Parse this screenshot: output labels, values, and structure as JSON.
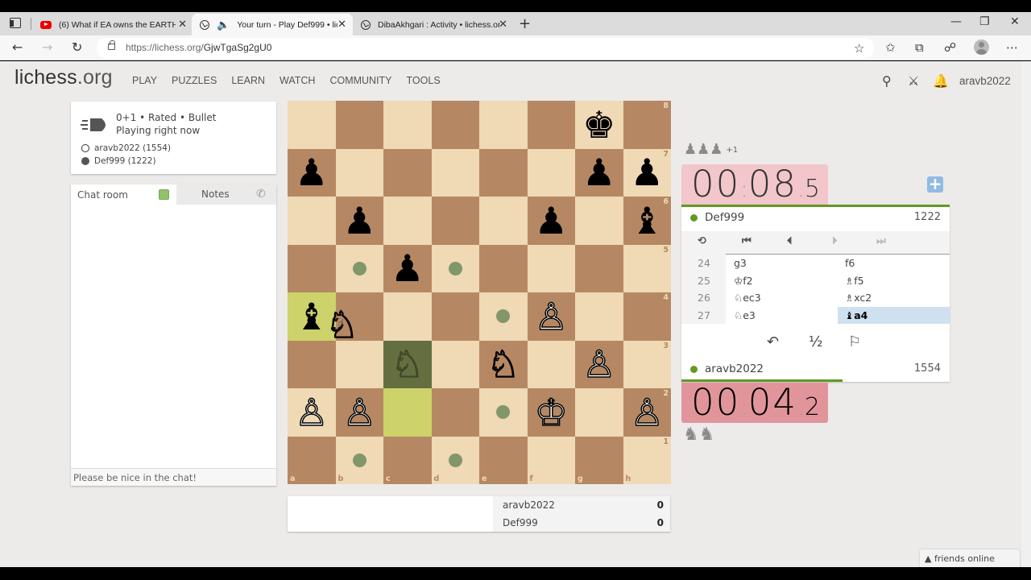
{
  "browser": {
    "tabs": [
      {
        "title": "(6) What if EA owns the EARTH |",
        "icon": "youtube-icon",
        "active": false
      },
      {
        "title": "Your turn - Play Def999 • lic",
        "icon": "lichess-icon",
        "audio": true,
        "active": true
      },
      {
        "title": "DibaAkhgari : Activity • lichess.or",
        "icon": "lichess-icon",
        "active": false
      }
    ],
    "url_host": "https://lichess.org/",
    "url_path": "GjwTgaSg2gU0",
    "icons": {
      "back": "←",
      "forward": "→",
      "reload": "↻",
      "new_tab": "+",
      "minimize": "—",
      "maximize": "❐",
      "close": "✕",
      "more": "⋯",
      "tab_close": "✕",
      "speaker": "🔈"
    }
  },
  "site": {
    "logo_main": "lichess",
    "logo_suffix": ".org",
    "menu": [
      "PLAY",
      "PUZZLES",
      "LEARN",
      "WATCH",
      "COMMUNITY",
      "TOOLS"
    ],
    "username": "aravb2022"
  },
  "game_info": {
    "line1": "0+1 • Rated • Bullet",
    "line2": "Playing right now",
    "white_player": "aravb2022 (1554)",
    "black_player": "Def999 (1222)"
  },
  "chat": {
    "tab_chat": "Chat room",
    "tab_notes": "Notes",
    "placeholder": "Please be nice in the chat!"
  },
  "board": {
    "files": [
      "a",
      "b",
      "c",
      "d",
      "e",
      "f",
      "g",
      "h"
    ],
    "ranks": [
      "8",
      "7",
      "6",
      "5",
      "4",
      "3",
      "2",
      "1"
    ],
    "rows": [
      [
        "",
        "",
        "",
        "",
        "",
        "",
        "bk",
        ""
      ],
      [
        "bp",
        "",
        "",
        "",
        "",
        "",
        "bp",
        "bp"
      ],
      [
        "",
        "bp",
        "",
        "",
        "",
        "bp",
        "",
        "bb"
      ],
      [
        "",
        "",
        "bp",
        "",
        "",
        "",
        "",
        ""
      ],
      [
        "bb",
        "",
        "",
        "",
        "",
        "wp",
        "",
        ""
      ],
      [
        "",
        "",
        "wn*",
        "",
        "wn",
        "",
        "wp",
        ""
      ],
      [
        "wp",
        "wp",
        "",
        "",
        "",
        "wk",
        "",
        "wp"
      ],
      [
        "",
        "",
        "",
        "",
        "",
        "",
        "",
        ""
      ]
    ],
    "last_move_squares": [
      "c2",
      "a4"
    ],
    "selected_square": "c3",
    "move_dots": [
      "b5",
      "d5",
      "e4",
      "e2",
      "b1",
      "d1"
    ],
    "dragging_piece": "wn",
    "glyphs": {
      "wk": "♔",
      "wq": "♕",
      "wr": "♖",
      "wb": "♗",
      "wn": "♘",
      "wp": "♙",
      "bk": "♚",
      "bq": "♛",
      "br": "♜",
      "bb": "♝",
      "bn": "♞",
      "bp": "♟"
    }
  },
  "crosstable": {
    "rows": [
      {
        "name": "aravb2022",
        "score": "0"
      },
      {
        "name": "Def999",
        "score": "0"
      }
    ]
  },
  "right_panel": {
    "top_material": {
      "pieces": "♟♟♟",
      "diff": "+1"
    },
    "bottom_material": {
      "pieces": "♞♞"
    },
    "top_clock": {
      "minutes": "00",
      "seconds": "08",
      "tenths": "5"
    },
    "bottom_clock": {
      "minutes": "00",
      "seconds": "04",
      "tenths": "2"
    },
    "opponent": {
      "name": "Def999",
      "rating": "1222"
    },
    "me": {
      "name": "aravb2022",
      "rating": "1554"
    },
    "controls": {
      "flip": "⟲",
      "first": "⏮",
      "prev": "⏴",
      "next": "⏵",
      "last": "⏭"
    },
    "moves": [
      {
        "num": "24",
        "white": "g3",
        "black": "f6"
      },
      {
        "num": "25",
        "white": "♔f2",
        "black": "♗f5"
      },
      {
        "num": "26",
        "white": "♘ec3",
        "black": "♗xc2"
      },
      {
        "num": "27",
        "white": "♘e3",
        "black": "♝a4"
      }
    ],
    "actions": {
      "takeback": "↶",
      "draw": "½",
      "resign": "⚐"
    },
    "clock_bar_fraction": 0.6,
    "plus_label": "+"
  },
  "friends": {
    "label": "▲ friends online"
  }
}
